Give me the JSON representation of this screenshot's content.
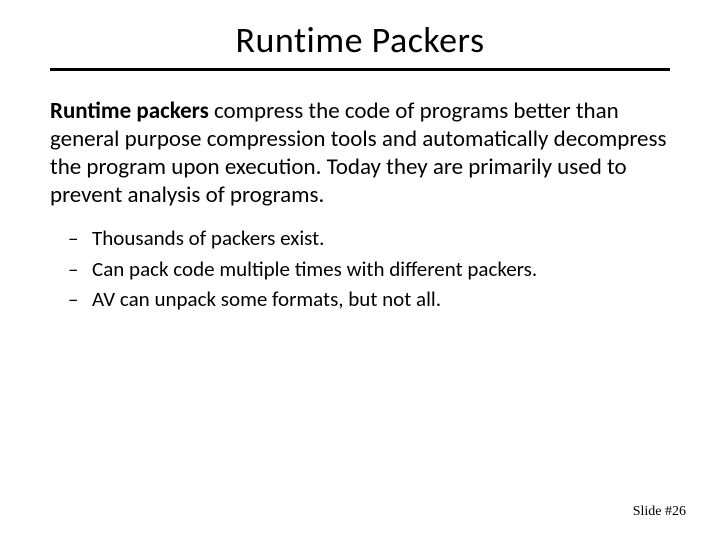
{
  "title": "Runtime Packers",
  "body": {
    "lead": "Runtime packers",
    "rest": " compress the code of programs better than general purpose compression tools and automatically decompress the program upon execution.  Today they are primarily used to prevent analysis of programs."
  },
  "bullets": [
    "Thousands of packers exist.",
    "Can pack code multiple times with different packers.",
    "AV can unpack some formats, but not all."
  ],
  "footer": "Slide #26"
}
